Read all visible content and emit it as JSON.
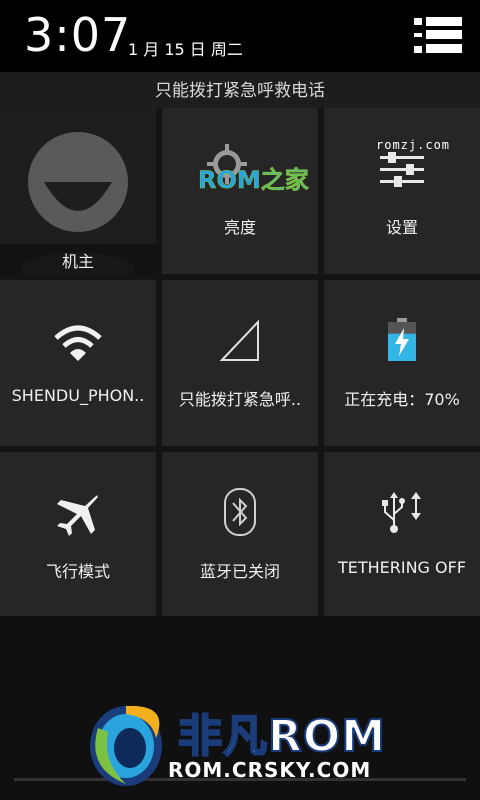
{
  "status": {
    "time": "3:07",
    "date": "1 月 15 日 周二"
  },
  "emergency_text": "只能拨打紧急呼救电话",
  "tiles": {
    "owner": {
      "label": "机主",
      "icon": "user-avatar-icon"
    },
    "brightness": {
      "label": "亮度",
      "logo_text": "ROM之家",
      "icon": "brightness-sun-icon"
    },
    "settings": {
      "label": "设置",
      "watermark": "romzj.com",
      "icon": "settings-sliders-icon"
    },
    "wifi": {
      "label": "SHENDU_PHON..",
      "icon": "wifi-icon"
    },
    "signal": {
      "label": "只能拨打紧急呼..",
      "icon": "signal-strength-icon"
    },
    "battery": {
      "label": "正在充电：70%",
      "icon": "battery-charging-icon",
      "level_percent": 70
    },
    "airplane": {
      "label": "飞行模式",
      "icon": "airplane-icon"
    },
    "bluetooth": {
      "label": "蓝牙已关闭",
      "icon": "bluetooth-icon"
    },
    "tethering": {
      "label": "TETHERING OFF",
      "icon": "usb-icon"
    }
  },
  "watermark": {
    "name": "非凡ROM",
    "url": "ROM.CRSKY.COM"
  },
  "colors": {
    "tile_bg": "#262626",
    "accent_blue": "#2aa4dc",
    "battery_blue": "#33b5e5",
    "logo_green": "#7cc142"
  }
}
